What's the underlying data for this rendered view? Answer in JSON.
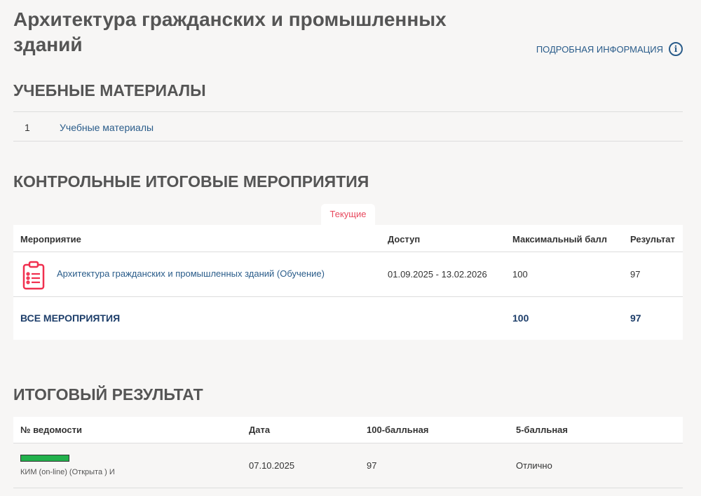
{
  "title": "Архитектура гражданских и промышленных зданий",
  "more_info": "ПОДРОБНАЯ ИНФОРМАЦИЯ",
  "materials": {
    "heading": "УЧЕБНЫЕ МАТЕРИАЛЫ",
    "items": [
      {
        "num": "1",
        "label": "Учебные материалы"
      }
    ]
  },
  "control": {
    "heading": "КОНТРОЛЬНЫЕ ИТОГОВЫЕ МЕРОПРИЯТИЯ",
    "tab": "Текущие",
    "columns": [
      "Мероприятие",
      "Доступ",
      "Максимальный балл",
      "Результат"
    ],
    "rows": [
      {
        "name": "Архитектура гражданских и промышленных зданий (Обучение)",
        "access": "01.09.2025 - 13.02.2026",
        "max": "100",
        "result": "97"
      }
    ],
    "total": {
      "label": "ВСЕ МЕРОПРИЯТИЯ",
      "max": "100",
      "result": "97"
    }
  },
  "final": {
    "heading": "ИТОГОВЫЙ РЕЗУЛЬТАТ",
    "columns": [
      "№ ведомости",
      "Дата",
      "100-балльная",
      "5-балльная"
    ],
    "rows": [
      {
        "status_color": "#22b14c",
        "statement": "КИМ (on-line) (Открыта ) И",
        "date": "07.10.2025",
        "score100": "97",
        "score5": "Отлично"
      }
    ]
  },
  "colors": {
    "accent": "#2a5c8a",
    "tab": "#e8495e",
    "icon": "#f0304f"
  }
}
